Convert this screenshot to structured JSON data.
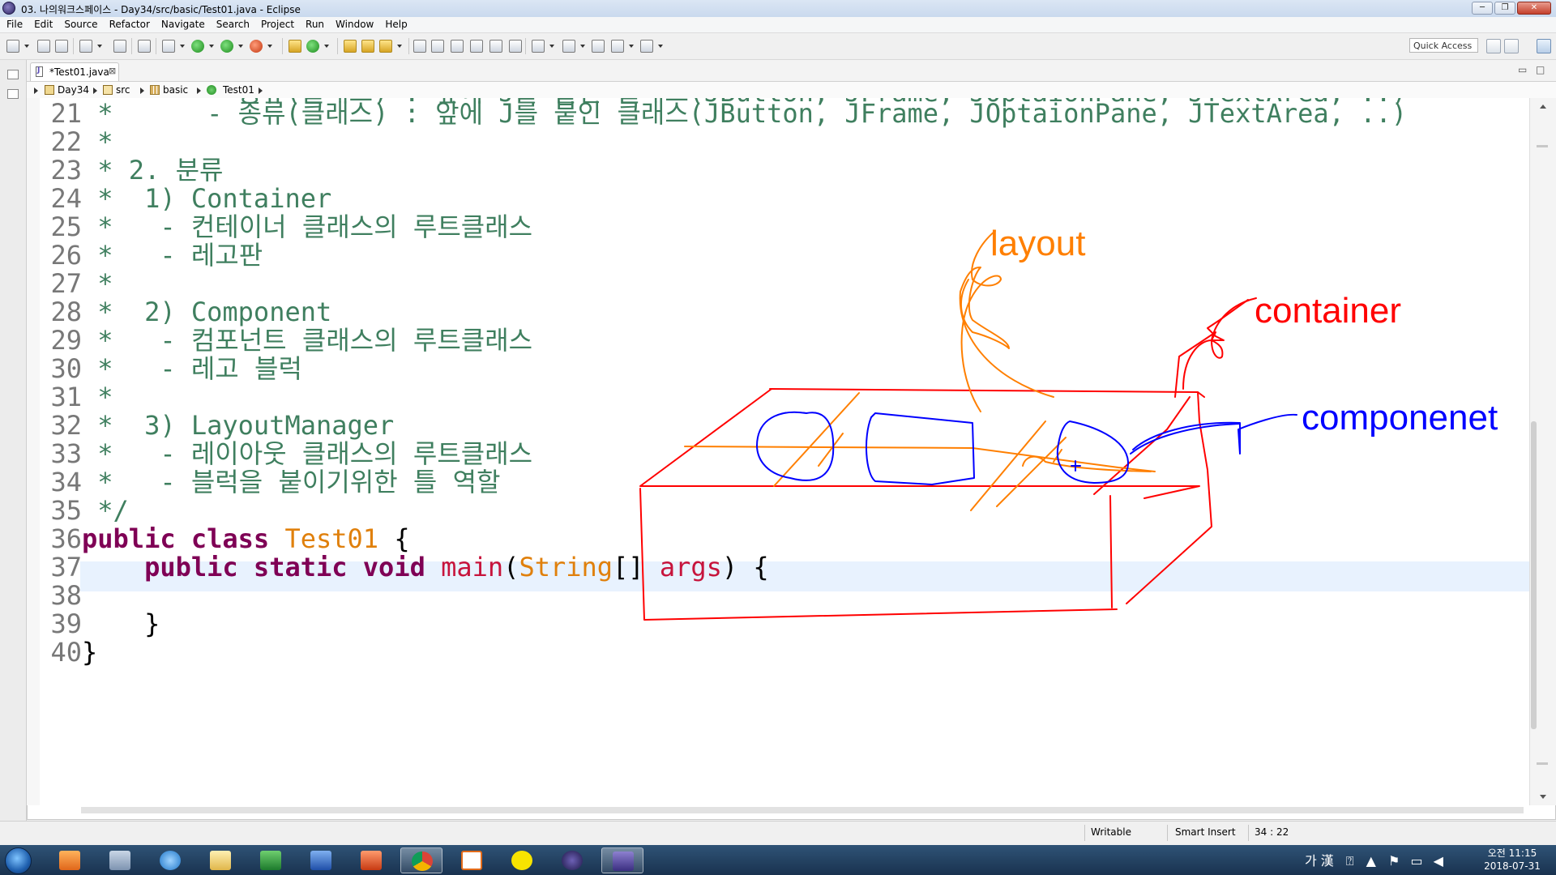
{
  "window": {
    "title": "03. 나의워크스페이스 - Day34/src/basic/Test01.java - Eclipse",
    "controls": [
      "─",
      "❐",
      "✕"
    ]
  },
  "menu": [
    "File",
    "Edit",
    "Source",
    "Refactor",
    "Navigate",
    "Search",
    "Project",
    "Run",
    "Window",
    "Help"
  ],
  "toolbar": {
    "quick_access_placeholder": "Quick Access"
  },
  "editor": {
    "tab_label": "*Test01.java",
    "tab_close": "⊠",
    "minimize": "▭",
    "maximize": "□",
    "breadcrumb": [
      "Day34",
      "src",
      "basic",
      "Test01"
    ]
  },
  "code": {
    "partial_top": " *      - 종류(클래스) : 앞에 J를 붙인 클래스(JButton, JFrame, JOptaionPane, JTextArea, ..)",
    "lines": [
      {
        "n": "21",
        "text": " *      - 종류(클래스) : 앞에 J를 붙인 클래스(JButton, JFrame, JOptaionPane, JTextArea, ..)"
      },
      {
        "n": "22",
        "text": " *"
      },
      {
        "n": "23",
        "text": " * 2. 분류"
      },
      {
        "n": "24",
        "text": " *  1) Container"
      },
      {
        "n": "25",
        "text": " *   - 컨테이너 클래스의 루트클래스"
      },
      {
        "n": "26",
        "text": " *   - 레고판"
      },
      {
        "n": "27",
        "text": " *"
      },
      {
        "n": "28",
        "text": " *  2) Component"
      },
      {
        "n": "29",
        "text": " *   - 컴포넌트 클래스의 루트클래스"
      },
      {
        "n": "30",
        "text": " *   - 레고 블럭"
      },
      {
        "n": "31",
        "text": " *"
      },
      {
        "n": "32",
        "text": " *  3) LayoutManager"
      },
      {
        "n": "33",
        "text": " *   - 레이아웃 클래스의 루트클래스"
      },
      {
        "n": "34",
        "text": " *   - 블럭을 붙이기위한 틀 역할"
      },
      {
        "n": "35",
        "text": " */"
      }
    ],
    "line36": {
      "n": "36",
      "kw1": "public",
      "kw2": "class",
      "name": "Test01",
      "brace": "{"
    },
    "line37": {
      "n": "37",
      "kw1": "public",
      "kw2": "static",
      "kw3": "void",
      "method": "main",
      "open": "(",
      "type": "String",
      "arr": "[]",
      "param": "args",
      "close": ") {"
    },
    "line38": {
      "n": "38"
    },
    "line39": {
      "n": "39",
      "text": "}"
    },
    "line40": {
      "n": "40",
      "text": "}"
    }
  },
  "annotations": {
    "layout_label": "layout",
    "container_label": "container",
    "component_label": "componenet",
    "colors": {
      "layout": "#ff7f00",
      "container": "#ff0000",
      "component": "#0000ff"
    }
  },
  "status": {
    "writable": "Writable",
    "insert_mode": "Smart Insert",
    "position": "34 : 22"
  },
  "taskbar": {
    "ime": "가 漢",
    "clock_time": "오전 11:15",
    "clock_date": "2018-07-31"
  }
}
